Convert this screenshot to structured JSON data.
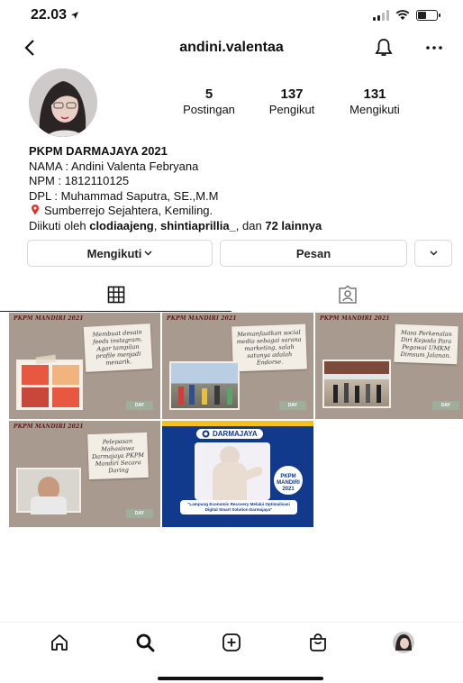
{
  "status": {
    "time": "22.03",
    "location_icon": "location-arrow-icon"
  },
  "header": {
    "username": "andini.valentaa"
  },
  "stats": [
    {
      "num": "5",
      "label": "Postingan"
    },
    {
      "num": "137",
      "label": "Pengikut"
    },
    {
      "num": "131",
      "label": "Mengikuti"
    }
  ],
  "bio": {
    "name": "PKPM DARMAJAYA 2021",
    "line1": "NAMA : Andini Valenta Febryana",
    "line2": "NPM : 1812110125",
    "line3": "DPL : Muhammad Saputra, SE.,M.M",
    "location": "Sumberrejo Sejahtera, Kemiling.",
    "followed_prefix": "Diikuti oleh",
    "followed_user1": "clodiaajeng",
    "followed_user2": "shintiaprillia_",
    "followed_mid": ", dan",
    "followed_count": "72 lainnya"
  },
  "actions": {
    "follow": "Mengikuti",
    "message": "Pesan"
  },
  "posts": [
    {
      "header": "PKPM MANDIRI 2021",
      "caption": "Membuat desain feeds instagram. Agar tampilan profile menjadi menarik.",
      "day": "DAY"
    },
    {
      "header": "PKPM MANDIRI 2021",
      "caption": "Memanfaatkan social media sebagai sarana marketing, salah satunya adalah Endorse.",
      "day": "DAY"
    },
    {
      "header": "PKPM MANDIRI 2021",
      "caption": "Masa Perkenalan Diri Kepada Para Pegawai UMKM Dimsum Jalanan.",
      "day": "DAY"
    },
    {
      "header": "PKPM MANDIRI 2021",
      "caption": "Pelepasan Mahasiswa Darmajaya PKPM Mandiri Secara Daring",
      "day": "DAY"
    },
    {
      "logo": "DARMAJAYA",
      "badge": "PKPM MANDIRI 2021",
      "slogan": "\"Lampung Economic Recovery Melalui Optimalisasi Digital Smart Solution Darmajaya\""
    }
  ],
  "colors": {
    "accent": "#123a8c",
    "dj_yellow": "#f4c01e",
    "post_bg": "#a89a8e"
  }
}
